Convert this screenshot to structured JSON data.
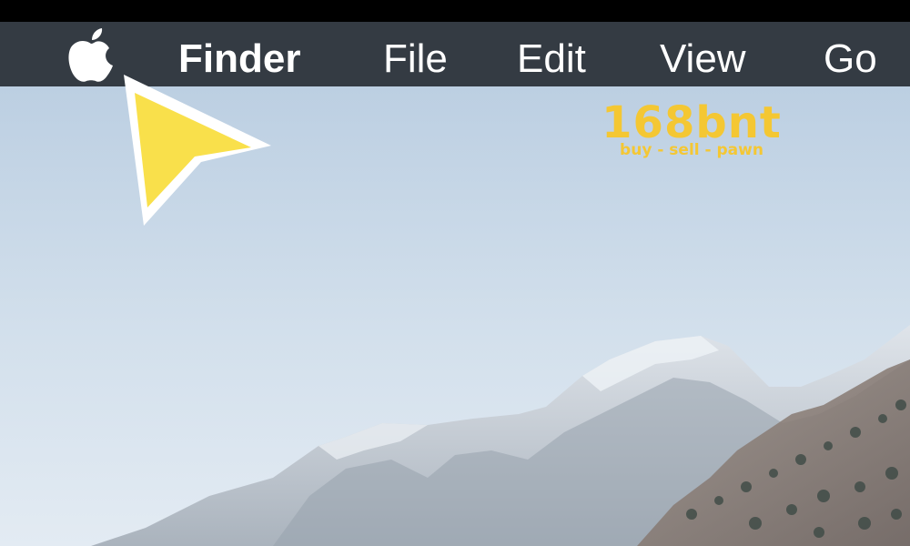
{
  "menubar": {
    "apple_menu_icon": "apple-logo-icon",
    "items": [
      {
        "label": "Finder",
        "bold": true
      },
      {
        "label": "File"
      },
      {
        "label": "Edit"
      },
      {
        "label": "View"
      },
      {
        "label": "Go"
      }
    ]
  },
  "desktop": {
    "wallpaper": "snowy-mountain-ridge"
  },
  "watermark": {
    "main": "168bnt",
    "sub": "buy - sell - pawn"
  },
  "pointer": {
    "icon": "yellow-arrow-pointer-icon",
    "fill": "#f9e04b",
    "stroke": "#ffffff"
  },
  "colors": {
    "menubar_bg": "#343b43",
    "menubar_text": "#ffffff",
    "watermark": "#f4c733",
    "sky_top": "#bccfe2",
    "sky_bottom": "#dfe9f2"
  }
}
